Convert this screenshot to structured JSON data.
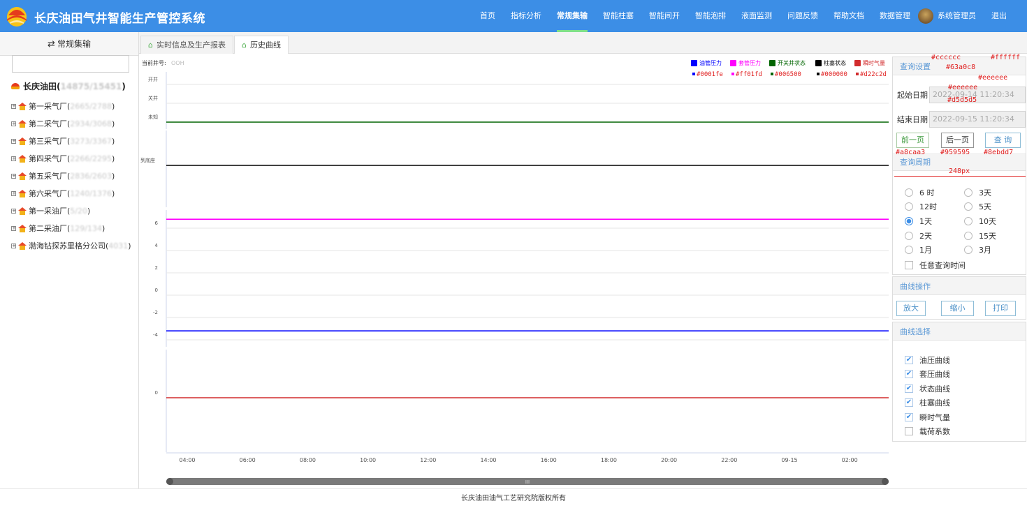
{
  "header": {
    "app_title": "长庆油田气井智能生产管控系统",
    "nav": [
      "首页",
      "指标分析",
      "常规集输",
      "智能柱塞",
      "智能间开",
      "智能泡排",
      "液面监测",
      "问题反馈",
      "帮助文档",
      "数据管理",
      "系统管理员",
      "退出"
    ],
    "active_nav_index": 2
  },
  "sidebar": {
    "title": "常规集输",
    "search_placeholder": "",
    "root_name": "长庆油田(",
    "root_counts": "14875/15451",
    "root_close": ")",
    "items": [
      {
        "name": "第一采气厂(",
        "count": "2665/2788",
        "close": ")"
      },
      {
        "name": "第二采气厂(",
        "count": "2934/3068",
        "close": ")"
      },
      {
        "name": "第三采气厂(",
        "count": "3273/3367",
        "close": ")"
      },
      {
        "name": "第四采气厂(",
        "count": "2266/2295",
        "close": ")"
      },
      {
        "name": "第五采气厂(",
        "count": "2836/2603",
        "close": ")"
      },
      {
        "name": "第六采气厂(",
        "count": "1240/1376",
        "close": ")"
      },
      {
        "name": "第一采油厂(",
        "count": "5/20",
        "close": ")"
      },
      {
        "name": "第二采油厂(",
        "count": "129/134",
        "close": ")"
      },
      {
        "name": "渤海钻探苏里格分公司(",
        "count": "4031",
        "close": ")"
      }
    ]
  },
  "tabs": [
    {
      "label": "实时信息及生产报表",
      "active": false
    },
    {
      "label": "历史曲线",
      "active": true
    }
  ],
  "chart": {
    "well_label": "当前井号:",
    "well_id": "OOH",
    "legend": [
      {
        "label": "油管压力",
        "color": "#0001fe",
        "color_code": "#0001fe"
      },
      {
        "label": "套管压力",
        "color": "#ff01fd",
        "color_code": "#ff01fd"
      },
      {
        "label": "开关井状态",
        "color": "#006500",
        "color_code": "#006500"
      },
      {
        "label": "柱塞状态",
        "color": "#000000",
        "color_code": "#000000"
      },
      {
        "label": "瞬时气量",
        "color": "#d22c2d",
        "color_code": "#d22c2d"
      }
    ]
  },
  "chart_data": {
    "type": "line",
    "x_ticks": [
      "04:00",
      "06:00",
      "08:00",
      "10:00",
      "12:00",
      "14:00",
      "16:00",
      "18:00",
      "20:00",
      "22:00",
      "09-15",
      "02:00"
    ],
    "panels": [
      {
        "y_ticks": [
          "开井",
          "关井",
          "未知"
        ],
        "series": [
          {
            "name": "开关井状态",
            "color": "#006500",
            "value": "未知"
          }
        ]
      },
      {
        "y_ticks": [
          "到底座"
        ],
        "series": [
          {
            "name": "柱塞状态",
            "color": "#000000",
            "value": "到底座"
          }
        ]
      },
      {
        "y_ticks": [
          "6",
          "4",
          "2",
          "0",
          "-2",
          "-4"
        ],
        "series": [
          {
            "name": "套管压力",
            "color": "#ff01fd",
            "value": 6.8
          },
          {
            "name": "油管压力",
            "color": "#0001fe",
            "value": -3.2
          }
        ]
      },
      {
        "y_ticks": [
          "0"
        ],
        "series": [
          {
            "name": "瞬时气量",
            "color": "#d22c2d",
            "value": 0
          }
        ]
      }
    ]
  },
  "scrollbar": {
    "grip": "III"
  },
  "query": {
    "title": "查询设置",
    "start_label": "起始日期",
    "start_value": "2022-09-14 11:20:34",
    "end_label": "结束日期",
    "end_value": "2022-09-15 11:20:34",
    "prev_btn": "前一页",
    "next_btn": "后一页",
    "query_btn": "查 询"
  },
  "period": {
    "title": "查询周期",
    "options": [
      {
        "label": "6 时",
        "checked": false
      },
      {
        "label": "3天",
        "checked": false
      },
      {
        "label": "12时",
        "checked": false
      },
      {
        "label": "5天",
        "checked": false
      },
      {
        "label": "1天",
        "checked": true
      },
      {
        "label": "10天",
        "checked": false
      },
      {
        "label": "2天",
        "checked": false
      },
      {
        "label": "15天",
        "checked": false
      },
      {
        "label": "1月",
        "checked": false
      },
      {
        "label": "3月",
        "checked": false
      }
    ],
    "custom_label": "任意查询时间"
  },
  "curve_ops": {
    "title": "曲线操作",
    "zoom_in": "放大",
    "zoom_out": "缩小",
    "print": "打印"
  },
  "curve_select": {
    "title": "曲线选择",
    "items": [
      {
        "label": "油压曲线",
        "checked": true
      },
      {
        "label": "套压曲线",
        "checked": true
      },
      {
        "label": "状态曲线",
        "checked": true
      },
      {
        "label": "柱塞曲线",
        "checked": true
      },
      {
        "label": "瞬时气量",
        "checked": true
      },
      {
        "label": "载荷系数",
        "checked": false
      }
    ]
  },
  "annotations": {
    "c_cccccc": "#cccccc",
    "c_ffffff": "#ffffff",
    "c_63a0c8": "#63a0c8",
    "c_eeeeee1": "#eeeeee",
    "c_eeeeee2": "#eeeeee",
    "c_d5d5d5": "#d5d5d5",
    "c_a8caa3": "#a8caa3",
    "c_959595": "#959595",
    "c_8ebdd7": "#8ebdd7",
    "width_248": "248px"
  },
  "footer": {
    "text": "长庆油田油气工艺研究院版权所有"
  }
}
